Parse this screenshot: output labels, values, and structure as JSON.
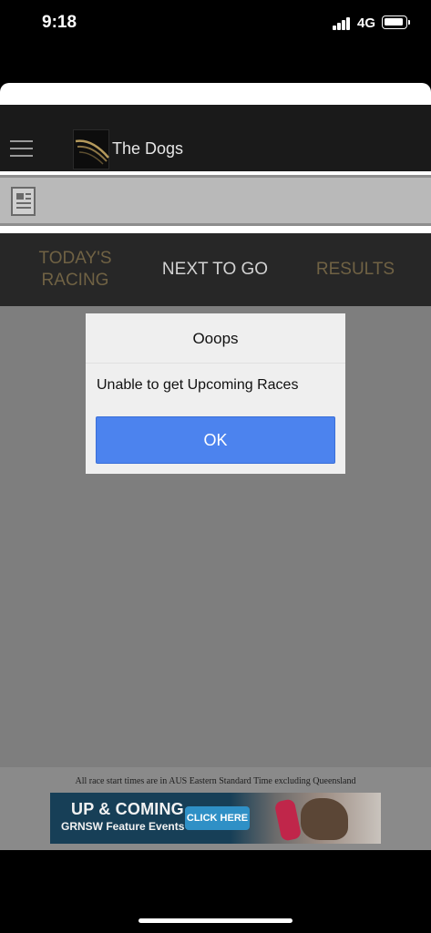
{
  "status_bar": {
    "time": "9:18",
    "network": "4G"
  },
  "header": {
    "title": "The Dogs"
  },
  "tabs": [
    {
      "label": "TODAY'S RACING",
      "state": "inactive"
    },
    {
      "label": "NEXT TO GO",
      "state": "active"
    },
    {
      "label": "RESULTS",
      "state": "inactive"
    }
  ],
  "dialog": {
    "title": "Ooops",
    "message": "Unable to get Upcoming Races",
    "ok_label": "OK"
  },
  "footer": {
    "timezone_note": "All race start times are in AUS Eastern Standard Time excluding Queensland",
    "ad": {
      "headline": "UP & COMING",
      "subline": "GRNSW Feature Events",
      "cta": "CLICK HERE"
    }
  },
  "colors": {
    "header_bg": "#1a1a1a",
    "tab_inactive": "#706244",
    "tab_active": "#d2d2d2",
    "ok_button": "#4c83ee",
    "overlay": "#7e7e7e"
  },
  "icons": [
    "signal-icon",
    "battery-icon",
    "menu-icon",
    "logo-icon",
    "news-icon"
  ]
}
